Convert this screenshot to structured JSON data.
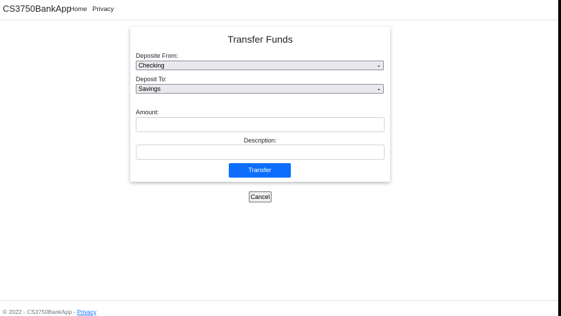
{
  "navbar": {
    "brand": "CS3750BankApp",
    "links": [
      "Home",
      "Privacy"
    ]
  },
  "form": {
    "title": "Transfer Funds",
    "from_label": "Deposite From:",
    "from_value": "Checking",
    "to_label": "Deposit To:",
    "to_value": "Savings",
    "amount_label": "Amount:",
    "amount_value": "",
    "description_label": "Description:",
    "description_value": "",
    "transfer_button": "Transfer",
    "cancel_button": "Cancel"
  },
  "footer": {
    "text": "© 2022 - CS3750BankApp - ",
    "privacy_link": "Privacy"
  },
  "colors": {
    "primary": "#0d6efd",
    "footer_text": "#6c757d"
  },
  "icons": {
    "select_chevron": "chevron-down-icon"
  }
}
